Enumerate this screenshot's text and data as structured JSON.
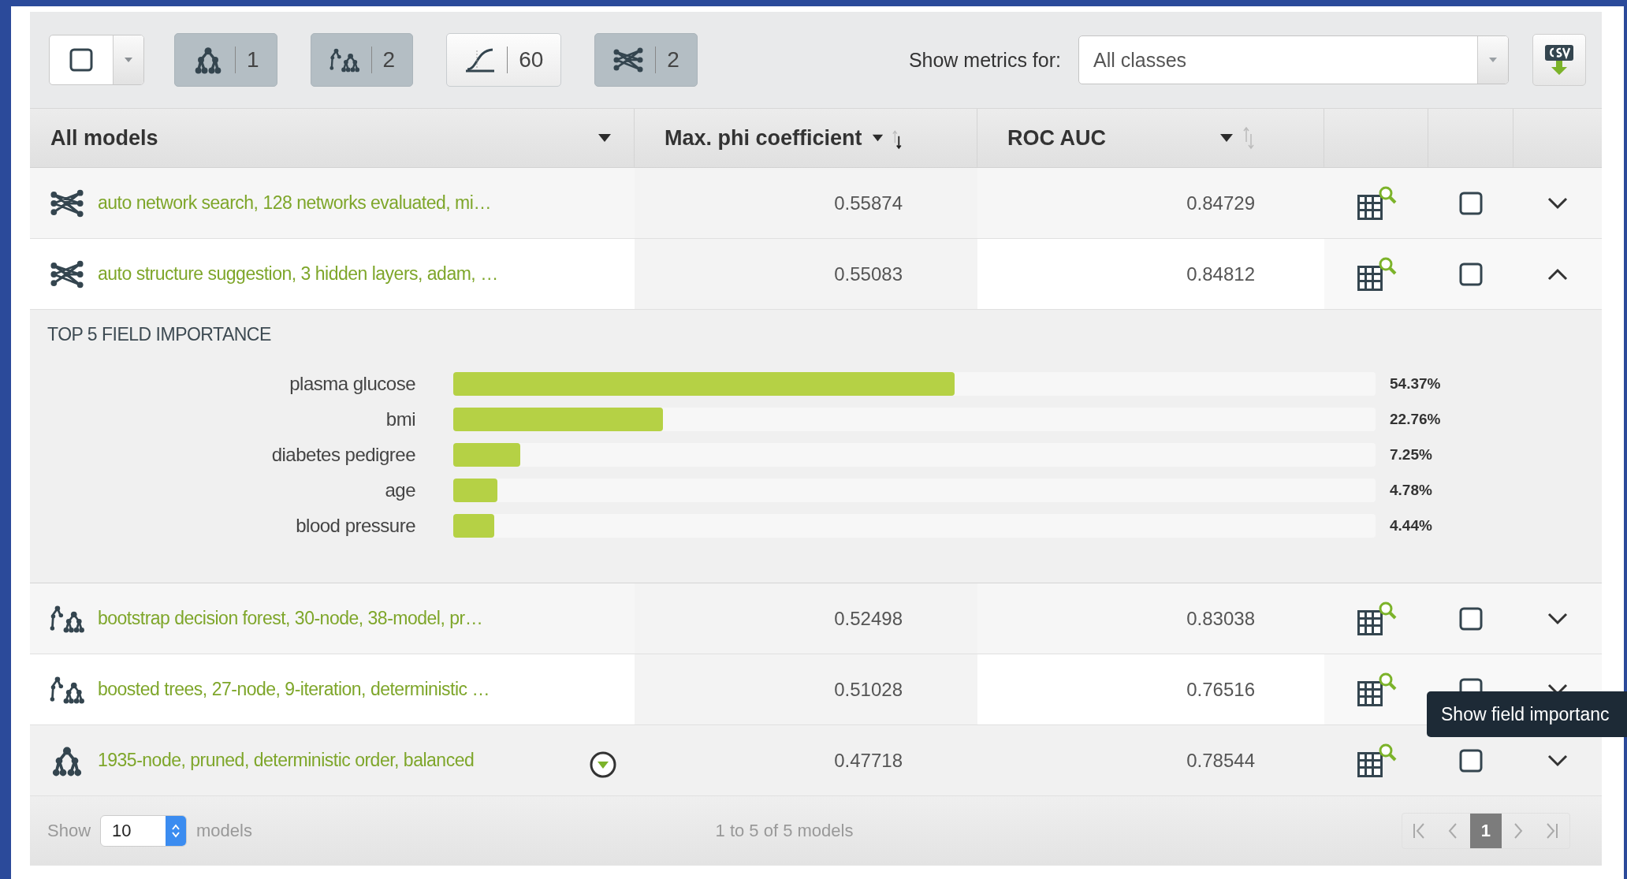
{
  "toolbar": {
    "select_all": {
      "checked": false
    },
    "filters": [
      {
        "kind": "tree",
        "count": "1",
        "selected": true
      },
      {
        "kind": "ensemble",
        "count": "2",
        "selected": true
      },
      {
        "kind": "logistic",
        "count": "60",
        "selected": false
      },
      {
        "kind": "deepnet",
        "count": "2",
        "selected": true
      }
    ],
    "metrics_label": "Show metrics for:",
    "metrics_value": "All classes"
  },
  "table": {
    "columns": [
      {
        "label": "All models"
      },
      {
        "label": "Max. phi coefficient",
        "sorted": true
      },
      {
        "label": "ROC AUC",
        "sorted": false
      }
    ],
    "rows": [
      {
        "kind": "deepnet",
        "name": "auto network search, 128 networks evaluated, mi…",
        "phi": "0.55874",
        "roc": "0.84729",
        "checked": false,
        "expanded": false,
        "hovered": false
      },
      {
        "kind": "deepnet",
        "name": "auto structure suggestion, 3 hidden layers, adam, …",
        "phi": "0.55083",
        "roc": "0.84812",
        "checked": false,
        "expanded": true,
        "hovered": false,
        "importance": {
          "title": "TOP 5 FIELD IMPORTANCE",
          "fields": [
            {
              "name": "plasma glucose",
              "level": 0.5437,
              "reading": "54.37%"
            },
            {
              "name": "bmi",
              "level": 0.2276,
              "reading": "22.76%"
            },
            {
              "name": "diabetes pedigree",
              "level": 0.0725,
              "reading": "7.25%"
            },
            {
              "name": "age",
              "level": 0.0478,
              "reading": "4.78%"
            },
            {
              "name": "blood pressure",
              "level": 0.0444,
              "reading": "4.44%"
            }
          ]
        }
      },
      {
        "kind": "ensemble",
        "name": "bootstrap decision forest, 30-node, 38-model, pr…",
        "phi": "0.52498",
        "roc": "0.83038",
        "checked": false,
        "expanded": false,
        "hovered": false
      },
      {
        "kind": "ensemble",
        "name": "boosted trees, 27-node, 9-iteration, deterministic …",
        "phi": "0.51028",
        "roc": "0.76516",
        "checked": false,
        "expanded": false,
        "hovered": false
      },
      {
        "kind": "tree",
        "name": "1935-node, pruned, deterministic order, balanced",
        "phi": "0.47718",
        "roc": "0.78544",
        "checked": false,
        "expanded": false,
        "hovered": true
      }
    ]
  },
  "tooltip": {
    "text": "Show field importanc"
  },
  "footer": {
    "show_label": "Show",
    "page_size": "10",
    "models_label": "models",
    "summary": "1 to 5 of 5 models",
    "pages": [
      {
        "label": "1",
        "selected": true
      }
    ]
  }
}
